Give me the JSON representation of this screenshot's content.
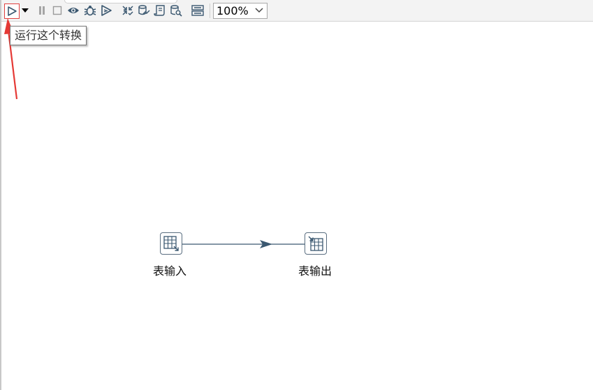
{
  "toolbar": {
    "buttons": [
      {
        "name": "run",
        "icon": "play-icon"
      },
      {
        "name": "run-options",
        "icon": "dropdown-arrow-icon"
      },
      {
        "name": "pause",
        "icon": "pause-icon"
      },
      {
        "name": "stop",
        "icon": "stop-icon"
      },
      {
        "name": "preview",
        "icon": "eye-icon"
      },
      {
        "name": "debug",
        "icon": "bug-icon"
      },
      {
        "name": "replay",
        "icon": "replay-icon"
      },
      {
        "name": "verify",
        "icon": "verify-icon"
      },
      {
        "name": "analyze-db-impact",
        "icon": "db-impact-icon"
      },
      {
        "name": "generate-sql",
        "icon": "sql-icon"
      },
      {
        "name": "explore-database",
        "icon": "db-explore-icon"
      },
      {
        "name": "show-results",
        "icon": "results-panel-icon"
      }
    ],
    "zoom": {
      "value": "100%"
    }
  },
  "tooltip": {
    "text": "运行这个转换"
  },
  "canvas": {
    "steps": [
      {
        "label": "表输入",
        "icon": "table-input-icon"
      },
      {
        "label": "表输出",
        "icon": "table-output-icon"
      }
    ],
    "hop_color": "#3b5870"
  },
  "colors": {
    "annotation_arrow": "#e53935",
    "icon": "#3b5870"
  }
}
